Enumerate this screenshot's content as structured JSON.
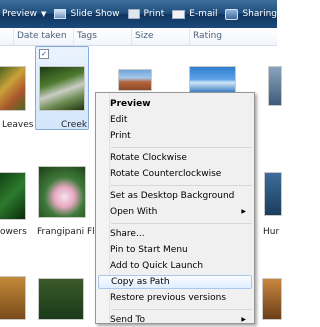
{
  "toolbar": {
    "preview_label": "Preview",
    "slideshow_label": "Slide Show",
    "print_label": "Print",
    "email_label": "E-mail",
    "sharing_label": "Sharing Settin"
  },
  "columns": [
    "Date taken",
    "Tags",
    "Size",
    "Rating"
  ],
  "thumbnails": {
    "row1": [
      "Leaves",
      "Creek"
    ],
    "row2": [
      "owers",
      "Frangipani Fl",
      "Hur"
    ]
  },
  "context_menu": {
    "items": [
      {
        "label": "Preview",
        "bold": true
      },
      {
        "label": "Edit"
      },
      {
        "label": "Print"
      },
      {
        "label": "Rotate Clockwise"
      },
      {
        "label": "Rotate Counterclockwise"
      },
      {
        "label": "Set as Desktop Background"
      },
      {
        "label": "Open With",
        "submenu": true
      },
      {
        "label": "Share..."
      },
      {
        "label": "Pin to Start Menu"
      },
      {
        "label": "Add to Quick Launch"
      },
      {
        "label": "Copy as Path",
        "highlighted": true
      },
      {
        "label": "Restore previous versions"
      },
      {
        "label": "Send To",
        "submenu": true
      }
    ]
  },
  "colors": {
    "toolbar": "#1f4d7c",
    "selection": "#d3e6fb",
    "menu_highlight_border": "#a8c8ec"
  }
}
